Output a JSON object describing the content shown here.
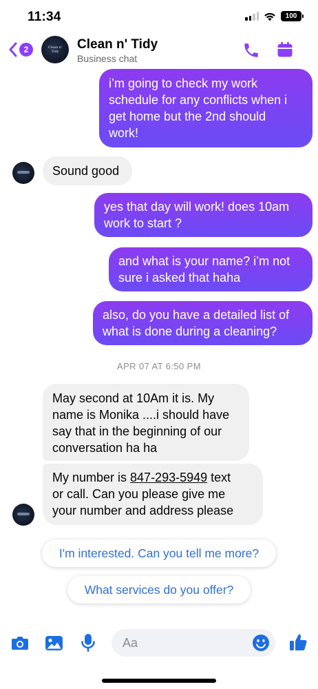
{
  "status": {
    "time": "11:34",
    "battery": "100"
  },
  "header": {
    "back_badge": "2",
    "title": "Clean n' Tidy",
    "subtitle": "Business chat",
    "avatar_logo_text": "Clean n' Tidy"
  },
  "messages": [
    {
      "direction": "outgoing",
      "lines": [
        "i’m going to check my work",
        "schedule for any conflicts when i",
        "get home but the 2nd should",
        "work!"
      ]
    },
    {
      "direction": "incoming",
      "lines": [
        "Sound good"
      ]
    },
    {
      "direction": "outgoing",
      "lines": [
        "yes that day will work! does 10am",
        "work to start ?"
      ]
    },
    {
      "direction": "outgoing",
      "lines": [
        "and what is your name? i’m not",
        "sure i asked that haha"
      ]
    },
    {
      "direction": "outgoing",
      "lines": [
        "also, do you have a detailed list of",
        "what is done during a cleaning?"
      ]
    },
    {
      "direction": "incoming",
      "lines": [
        "May second at 10Am it is. My",
        "name is Monika ....i should have",
        "say that in the beginning of our",
        "conversation ha ha"
      ]
    },
    {
      "direction": "incoming",
      "prefix": "My number is ",
      "link": "847-293-5949",
      "suffix": " text",
      "lines": [
        "or call. Can you please give me",
        "your number and address please"
      ]
    }
  ],
  "timestamp": "APR 07 AT 6:50 PM",
  "quick_replies": [
    "I'm interested. Can you tell me more?",
    "What services do you offer?"
  ],
  "composer": {
    "placeholder": "Aa"
  },
  "icons": {
    "header": [
      "back-chevron-icon",
      "phone-icon",
      "calendar-icon"
    ],
    "composer": [
      "camera-icon",
      "image-icon",
      "microphone-icon",
      "emoji-icon",
      "thumbs-up-icon"
    ]
  },
  "colors": {
    "accent": "#8a3ffc",
    "bubble_out_top": "#8d3bf0",
    "bubble_out_bottom": "#6a4cf5",
    "bubble_in": "#f0f0f0",
    "link_blue": "#2f6fd6",
    "composer_blue": "#1d6fe0"
  }
}
